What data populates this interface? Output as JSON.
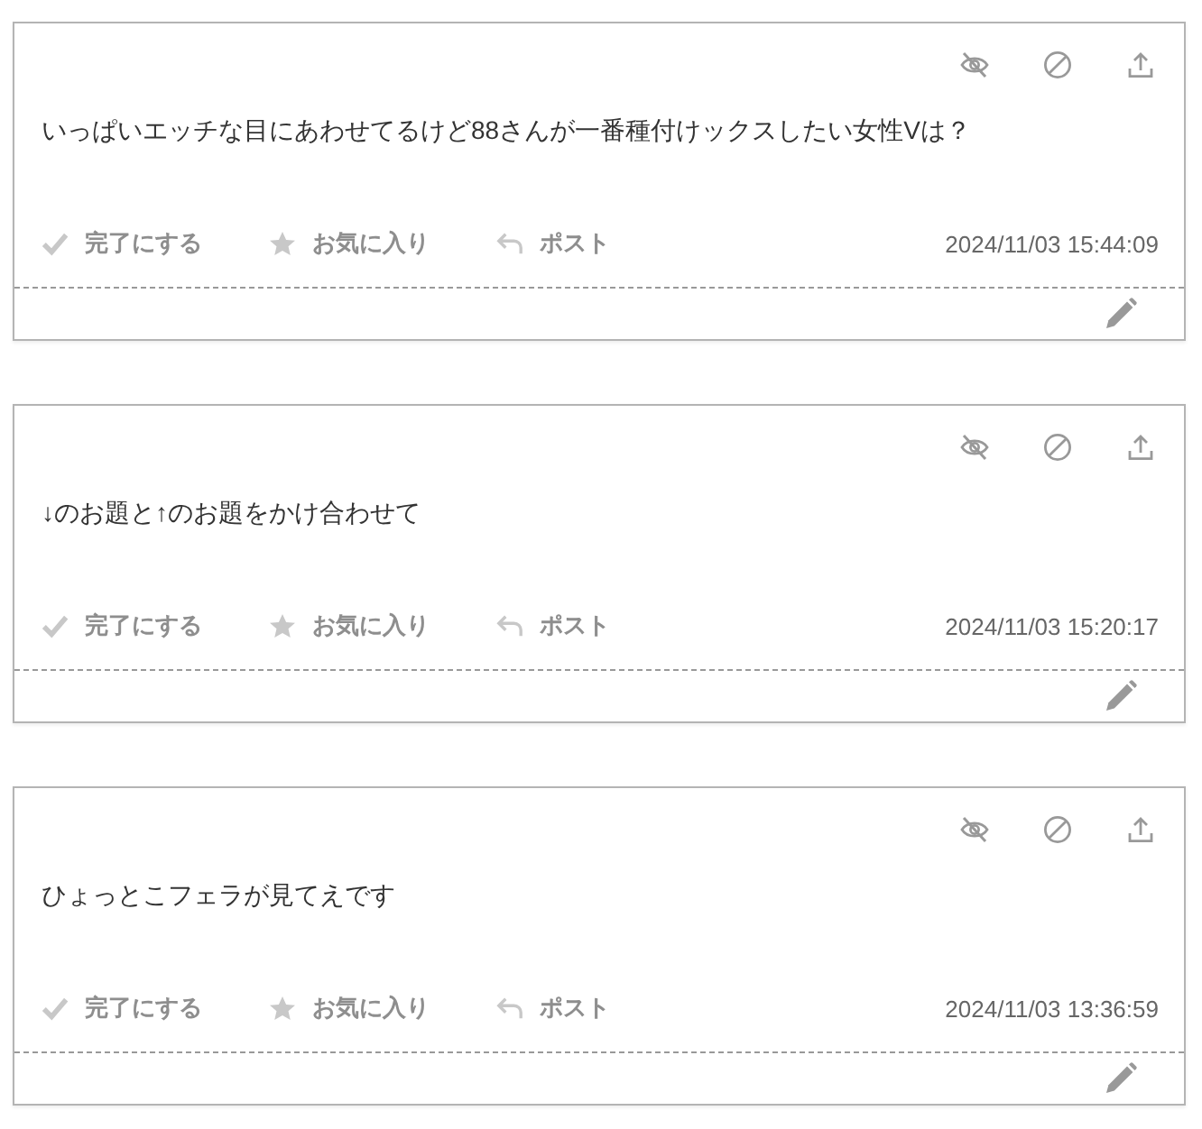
{
  "posts": [
    {
      "text": "いっぱいエッチな目にあわせてるけど88さんが一番種付けックスしたい女性Vは？",
      "actions": [
        {
          "kind": "done",
          "label": "完了にする",
          "on": false
        },
        {
          "kind": "favorite",
          "label": "お気に入り",
          "on": false
        },
        {
          "kind": "post",
          "label": "ポスト",
          "on": false
        }
      ],
      "timestamp": "2024/11/03 15:44:09"
    },
    {
      "text": "↓のお題と↑のお題をかけ合わせて",
      "actions": [
        {
          "kind": "done",
          "label": "完了にする",
          "on": false
        },
        {
          "kind": "favorite",
          "label": "お気に入り",
          "on": false
        },
        {
          "kind": "post",
          "label": "ポスト",
          "on": false
        }
      ],
      "timestamp": "2024/11/03 15:20:17"
    },
    {
      "text": "ひょっとこフェラが見てえです",
      "actions": [
        {
          "kind": "done",
          "label": "完了にする",
          "on": false
        },
        {
          "kind": "favorite",
          "label": "お気に入り",
          "on": false
        },
        {
          "kind": "post",
          "label": "ポスト",
          "on": false
        }
      ],
      "timestamp": "2024/11/03 13:36:59"
    }
  ]
}
